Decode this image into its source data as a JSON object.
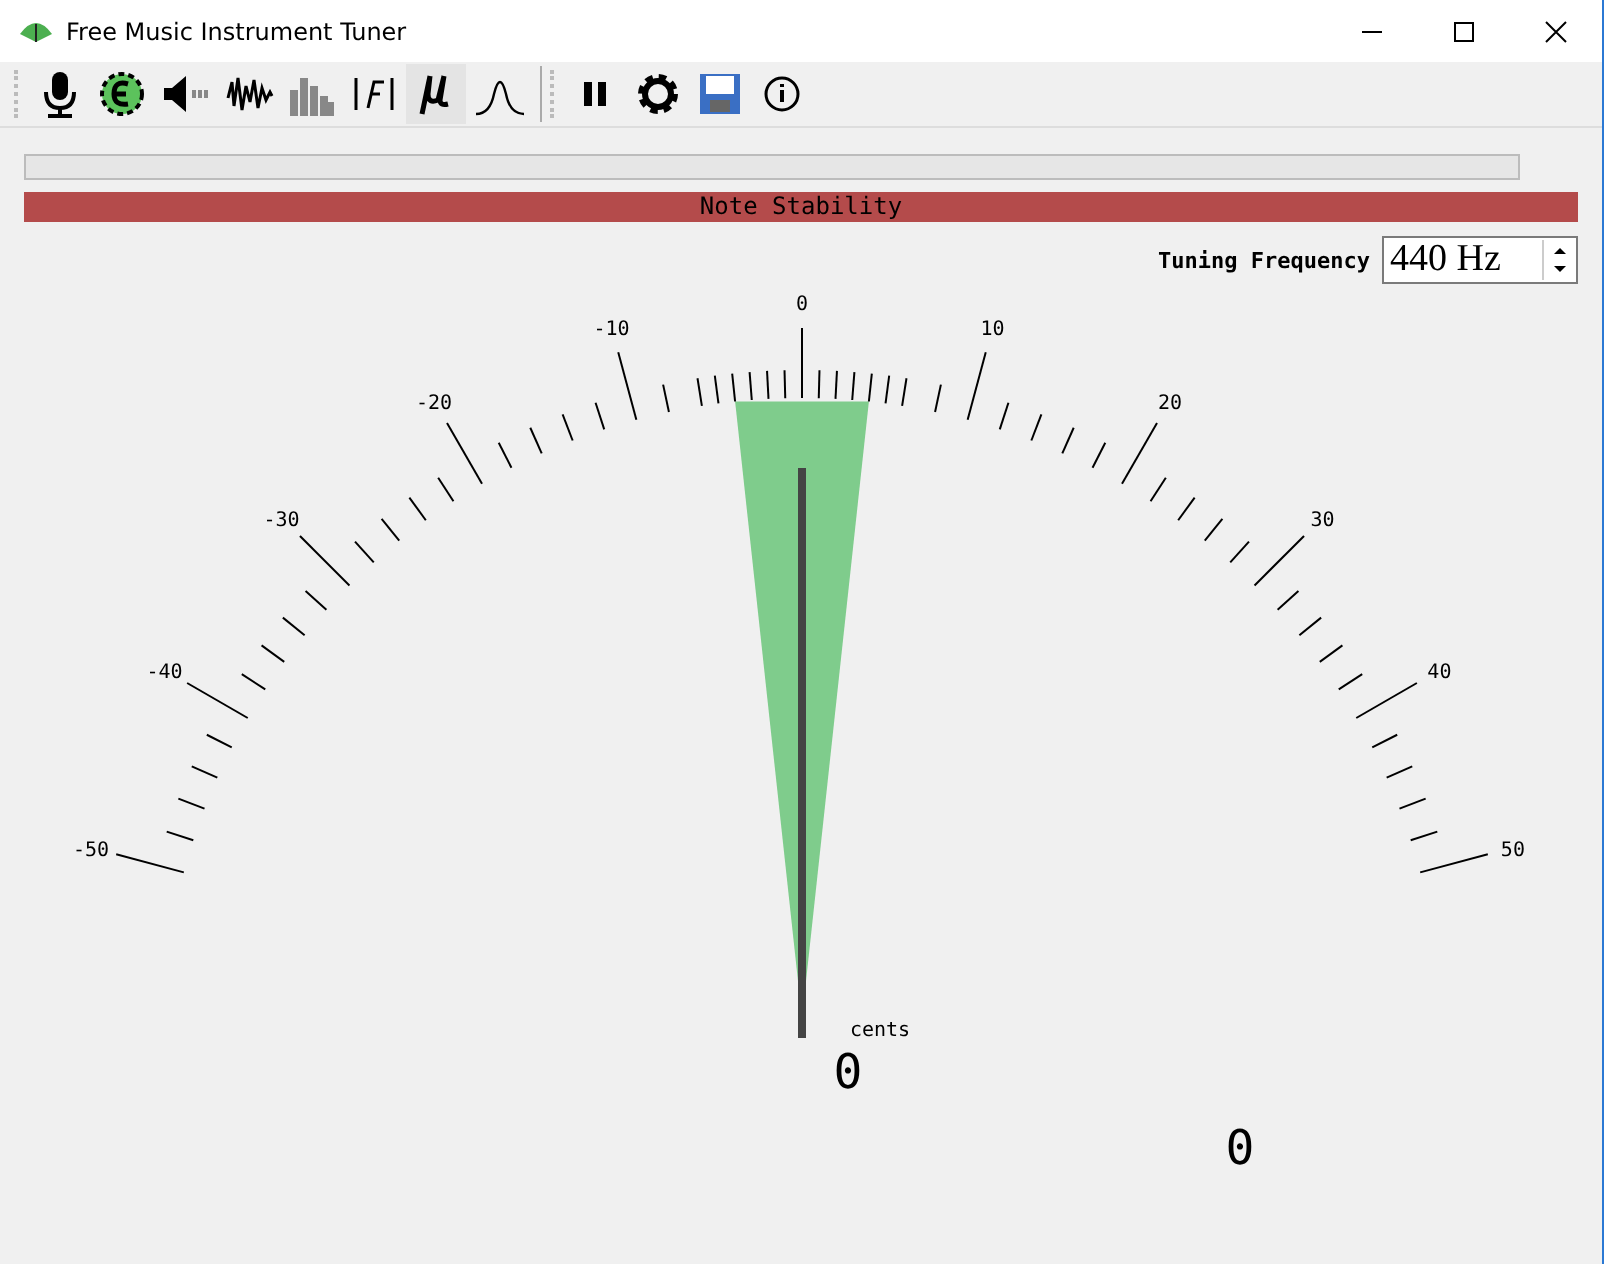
{
  "window": {
    "title": "Free Music Instrument Tuner"
  },
  "toolbar": [
    {
      "kind": "mic",
      "selected": false
    },
    {
      "kind": "ear",
      "selected": false
    },
    {
      "kind": "volume",
      "selected": false
    },
    {
      "kind": "wave",
      "selected": false
    },
    {
      "kind": "bars",
      "selected": false
    },
    {
      "kind": "formant",
      "selected": false
    },
    {
      "kind": "mu",
      "selected": true
    },
    {
      "kind": "gauss",
      "selected": false
    },
    {
      "kind": "sep"
    },
    {
      "kind": "pause",
      "selected": false
    },
    {
      "kind": "settings",
      "selected": false
    },
    {
      "kind": "save",
      "selected": false
    },
    {
      "kind": "info",
      "selected": false
    }
  ],
  "progress": {
    "level": 0
  },
  "stability": {
    "label": "Note Stability"
  },
  "tuning": {
    "label": "Tuning Frequency",
    "value": "440 Hz"
  },
  "gauge": {
    "labels": [
      "-50",
      "-40",
      "-30",
      "-20",
      "-10",
      "0",
      "10",
      "20",
      "30",
      "40",
      "50"
    ],
    "level": 0.5,
    "unit": "cents",
    "reading": "0",
    "secondary_reading": "0"
  }
}
